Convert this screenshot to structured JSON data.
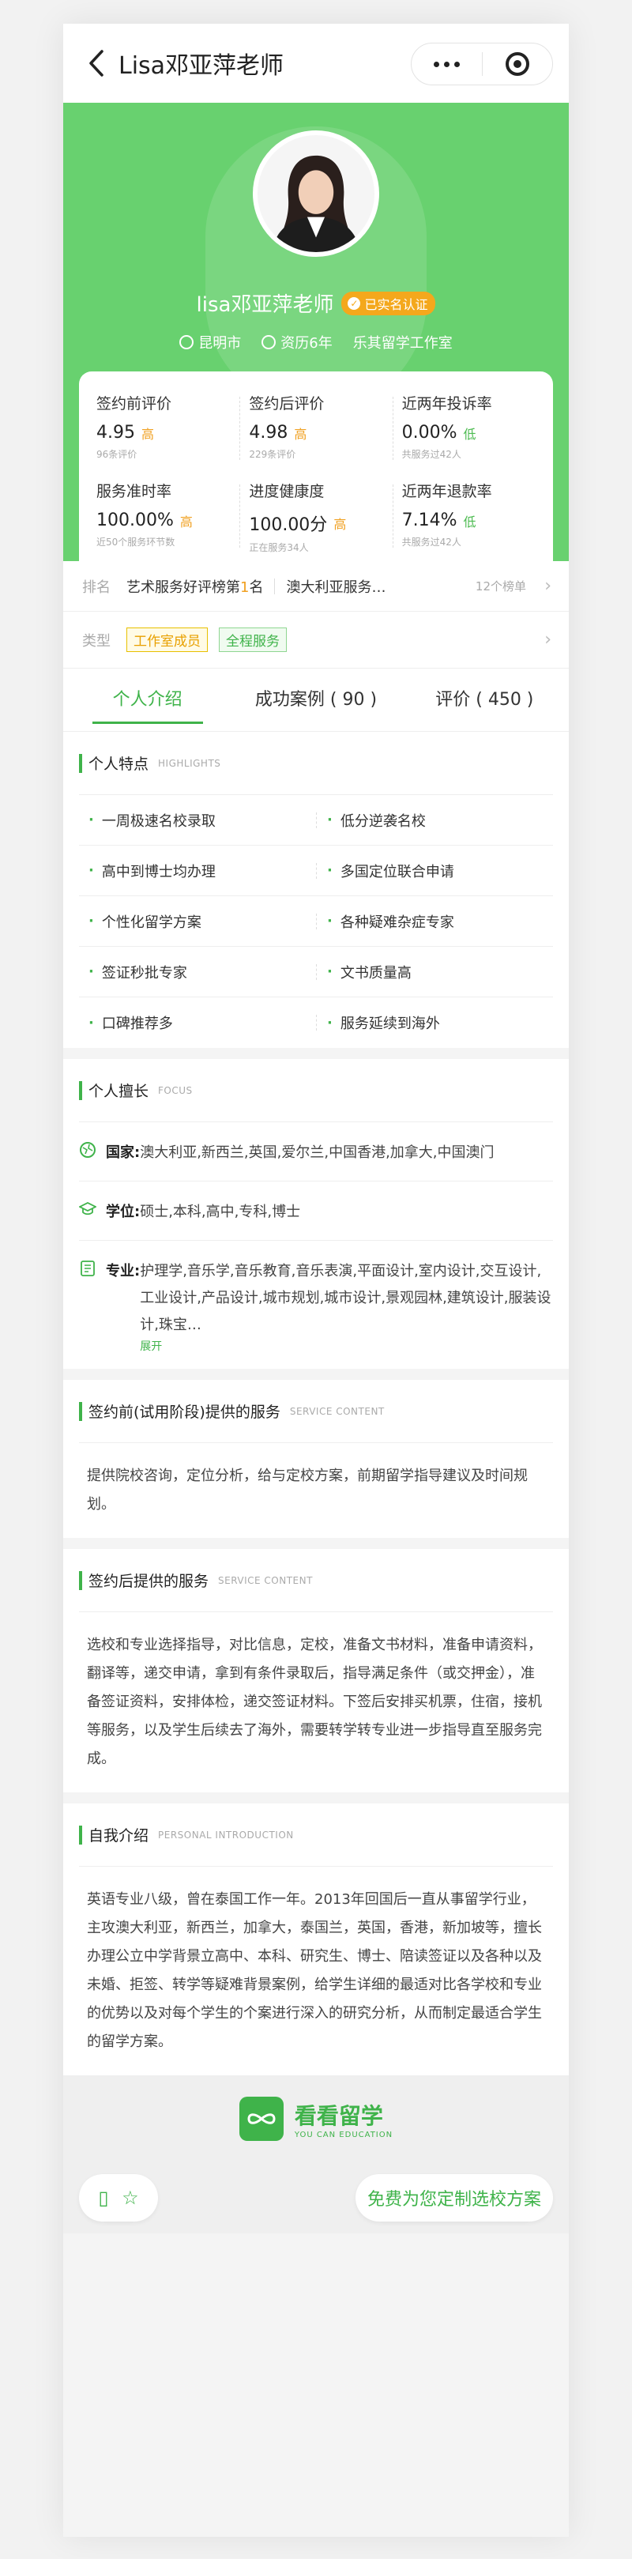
{
  "nav": {
    "title": "Lisa邓亚萍老师",
    "back_icon": "chevron-left-icon",
    "more_icon": "more-dots-icon",
    "close_icon": "target-icon"
  },
  "profile": {
    "name": "lisa邓亚萍老师",
    "verified_label": "已实名认证",
    "location": "昆明市",
    "experience": "资历6年",
    "studio": "乐其留学工作室"
  },
  "stats": [
    {
      "label": "签约前评价",
      "value": "4.95",
      "tag": "高",
      "tag_type": "high",
      "sub": "96条评价"
    },
    {
      "label": "签约后评价",
      "value": "4.98",
      "tag": "高",
      "tag_type": "high",
      "sub": "229条评价"
    },
    {
      "label": "近两年投诉率",
      "value": "0.00%",
      "tag": "低",
      "tag_type": "low",
      "sub": "共服务过42人"
    },
    {
      "label": "服务准时率",
      "value": "100.00%",
      "tag": "高",
      "tag_type": "high",
      "sub": "近50个服务环节数"
    },
    {
      "label": "进度健康度",
      "value": "100.00分",
      "tag": "高",
      "tag_type": "high",
      "sub": "正在服务34人"
    },
    {
      "label": "近两年退款率",
      "value": "7.14%",
      "tag": "低",
      "tag_type": "low",
      "sub": "共服务过42人"
    }
  ],
  "rank": {
    "key": "排名",
    "item1_prefix": "艺术服务好评榜第",
    "item1_num": "1",
    "item1_suffix": "名",
    "item2": "澳大利亚服务…",
    "count": "12个榜单"
  },
  "type": {
    "key": "类型",
    "pill1": "工作室成员",
    "pill2": "全程服务"
  },
  "tabs": [
    {
      "label": "个人介绍"
    },
    {
      "label": "成功案例 ( 90 )"
    },
    {
      "label": "评价 ( 450 )"
    }
  ],
  "highlights": {
    "title": "个人特点",
    "en": "HIGHLIGHTS",
    "items": [
      "一周极速名校录取",
      "低分逆袭名校",
      "高中到博士均办理",
      "多国定位联合申请",
      "个性化留学方案",
      "各种疑难杂症专家",
      "签证秒批专家",
      "文书质量高",
      "口碑推荐多",
      "服务延续到海外"
    ]
  },
  "focus": {
    "title": "个人擅长",
    "en": "FOCUS",
    "country_k": "国家:",
    "country_v": "澳大利亚,新西兰,英国,爱尔兰,中国香港,加拿大,中国澳门",
    "degree_k": "学位:",
    "degree_v": "硕士,本科,高中,专科,博士",
    "major_k": "专业:",
    "major_v": "护理学,音乐学,音乐教育,音乐表演,平面设计,室内设计,交互设计,工业设计,产品设计,城市规划,城市设计,景观园林,建筑设计,服装设计,珠宝…",
    "expand": "展开"
  },
  "pre_service": {
    "title": "签约前(试用阶段)提供的服务",
    "en": "SERVICE CONTENT",
    "text": "提供院校咨询，定位分析，给与定校方案，前期留学指导建议及时间规划。"
  },
  "post_service": {
    "title": "签约后提供的服务",
    "en": "SERVICE CONTENT",
    "text": "选校和专业选择指导，对比信息，定校，准备文书材料，准备申请资料，翻译等，递交申请，拿到有条件录取后，指导满足条件（或交押金），准备签证资料，安排体检，递交签证材料。下签后安排买机票，住宿，接机等服务，以及学生后续去了海外，需要转学转专业进一步指导直至服务完成。"
  },
  "intro": {
    "title": "自我介绍",
    "en": "PERSONAL INTRODUCTION",
    "text": "英语专业八级，曾在泰国工作一年。2013年回国后一直从事留学行业，主攻澳大利亚，新西兰，加拿大，泰国兰，英国，香港，新加坡等，擅长办理公立中学背景立高中、本科、研究生、博士、陪读签证以及各种以及未婚、拒签、转学等疑难背景案例，给学生详细的最适对比各学校和专业的优势以及对每个学生的个案进行深入的研究分析，从而制定最适合学生的留学方案。"
  },
  "brand": {
    "name": "看看留学",
    "en": "YOU CAN EDUCATION"
  },
  "footer": {
    "cta": "免费为您定制选校方案",
    "phone_icon": "phone-icon",
    "star_icon": "star-icon"
  },
  "colors": {
    "brand_green": "#3fb34a",
    "hero_green": "#68d16f",
    "high": "#f0a020",
    "low": "#4cbb50"
  }
}
